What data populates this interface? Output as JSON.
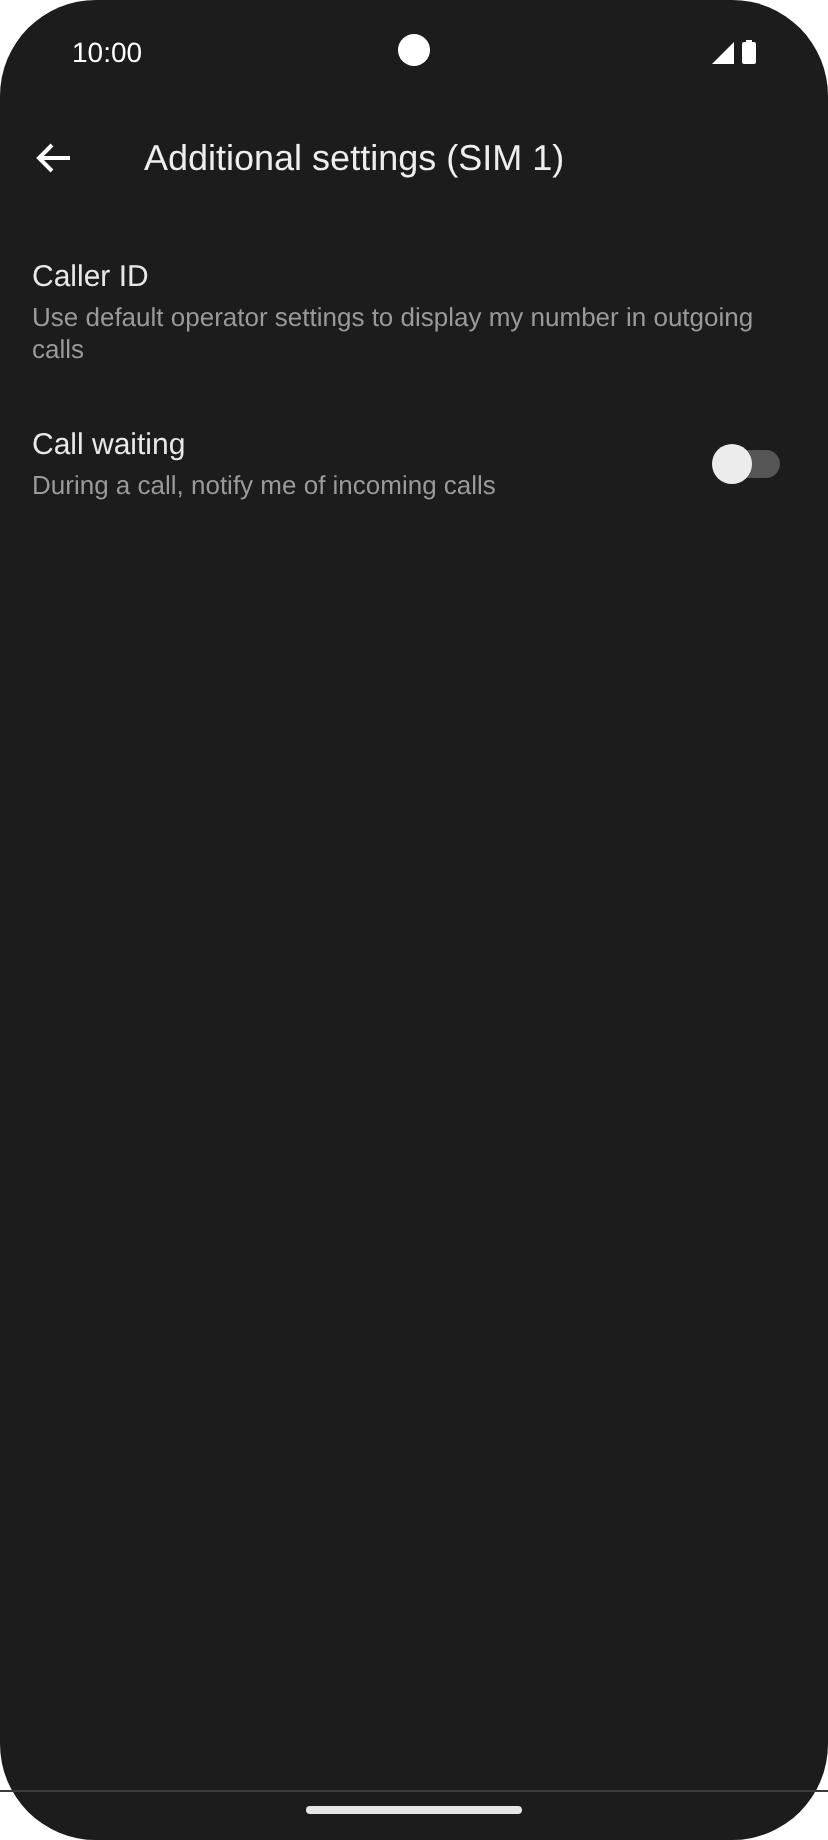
{
  "status_bar": {
    "time": "10:00"
  },
  "app_bar": {
    "title": "Additional settings (SIM 1)"
  },
  "settings": [
    {
      "kind": "text",
      "title": "Caller ID",
      "summary": "Use default operator settings to display my number in outgoing calls"
    },
    {
      "kind": "switch",
      "title": "Call waiting",
      "summary": "During a call, notify me of incoming calls",
      "on": false
    }
  ]
}
